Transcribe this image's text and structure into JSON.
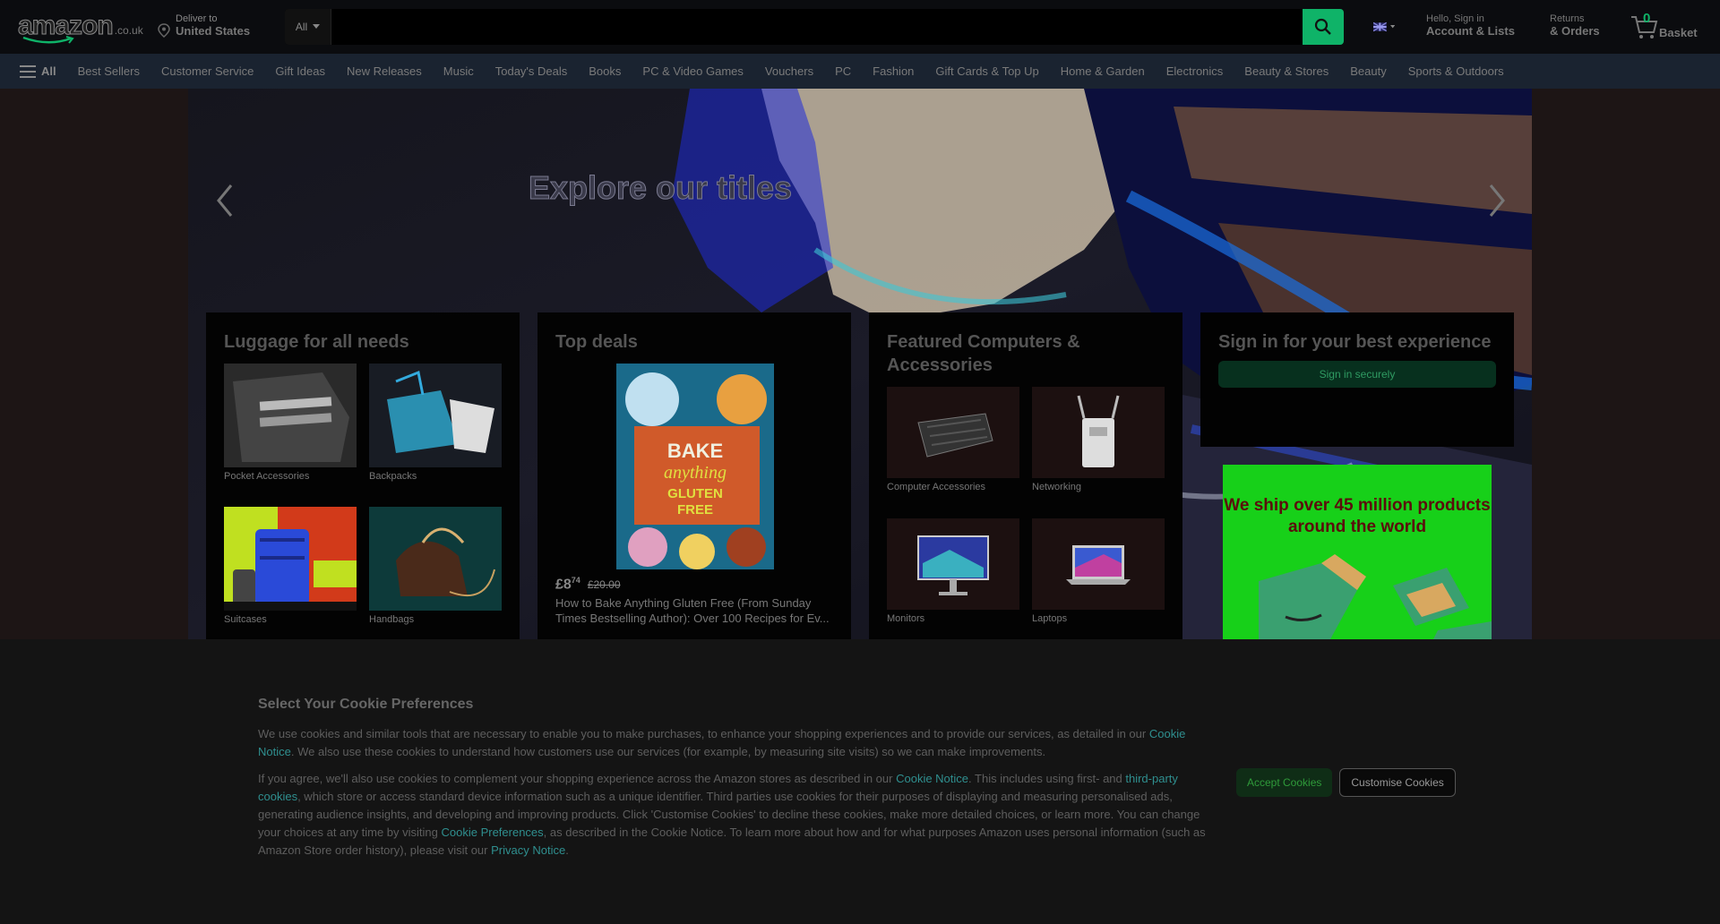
{
  "header": {
    "logo_text": "amazon",
    "logo_tld": ".co.uk",
    "deliver_label": "Deliver to",
    "deliver_location": "United States",
    "search_category": "All",
    "search_placeholder": "",
    "language": "EN",
    "account_line1": "Hello, Sign in",
    "account_line2": "Account & Lists",
    "returns_line1": "Returns",
    "returns_line2": "& Orders",
    "basket_count": "0",
    "basket_label": "Basket"
  },
  "nav": {
    "all_label": "All",
    "items": [
      "Best Sellers",
      "Customer Service",
      "Gift Ideas",
      "New Releases",
      "Music",
      "Today's Deals",
      "Books",
      "PC & Video Games",
      "Vouchers",
      "PC",
      "Fashion",
      "Gift Cards & Top Up",
      "Home & Garden",
      "Electronics",
      "Beauty & Stores",
      "Beauty",
      "Sports & Outdoors"
    ]
  },
  "hero": {
    "title": "Explore our titles"
  },
  "cards": {
    "luggage": {
      "title": "Luggage for all needs",
      "items": [
        "Pocket Accessories",
        "Backpacks",
        "Suitcases",
        "Handbags"
      ]
    },
    "deals": {
      "title": "Top deals",
      "price_whole": "£8",
      "price_fraction": "74",
      "was_price": "£20.00",
      "product": "How to Bake Anything Gluten Free (From Sunday Times Bestselling Author): Over 100 Recipes for Ev..."
    },
    "computers": {
      "title": "Featured Computers & Accessories",
      "items": [
        "Computer Accessories",
        "Networking",
        "Monitors",
        "Laptops"
      ]
    },
    "signin": {
      "title": "Sign in for your best experience",
      "button": "Sign in securely"
    },
    "ship_ad": {
      "text": "We ship over 45 million products around the world"
    }
  },
  "cookie": {
    "title": "Select Your Cookie Preferences",
    "p1_a": "We use cookies and similar tools that are necessary to enable you to make purchases, to enhance your shopping experiences and to provide our services, as detailed in our ",
    "p1_link": "Cookie Notice",
    "p1_b": ". We also use these cookies to understand how customers use our services (for example, by measuring site visits) so we can make improvements.",
    "p2_a": "If you agree, we'll also use cookies to complement your shopping experience across the Amazon stores as described in our ",
    "p2_link1": "Cookie Notice",
    "p2_b": ". This includes using first- and ",
    "p2_link2": "third-party cookies",
    "p2_c": ", which store or access standard device information such as a unique identifier. Third parties use cookies for their purposes of displaying and measuring personalised ads, generating audience insights, and developing and improving products. Click 'Customise Cookies' to decline these cookies, make more detailed choices, or learn more. You can change your choices at any time by visiting ",
    "p2_link3": "Cookie Preferences",
    "p2_d": ", as described in the Cookie Notice. To learn more about how and for what purposes Amazon uses personal information (such as Amazon Store order history), please visit our ",
    "p2_link4": "Privacy Notice",
    "p2_e": ".",
    "accept": "Accept Cookies",
    "customise": "Customise Cookies"
  },
  "colors": {
    "accent_green": "#0fb368",
    "header_bg": "#0b0c0f",
    "nav_bg": "#1a2330"
  }
}
